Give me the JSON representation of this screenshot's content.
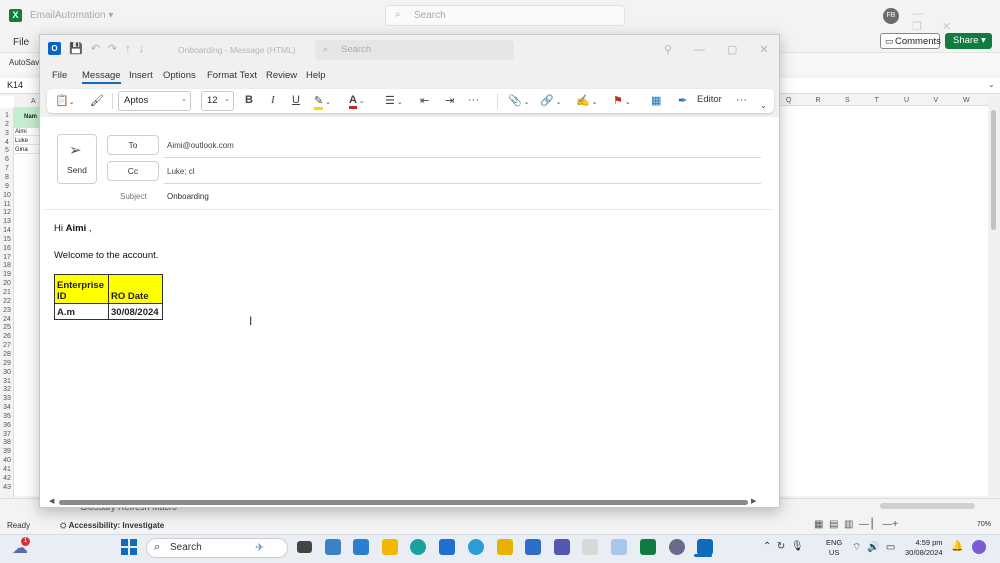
{
  "excel": {
    "app_letter": "X",
    "file_name": "EmailAutomation ▾",
    "search_placeholder": "Search",
    "avatar_initials": "FB",
    "menu_file": "File",
    "comments_label": "Comments",
    "share_label": "Share",
    "autosave_label": "AutoSave",
    "name_box": "K14",
    "column_a_letter": "A",
    "name_header": "Nam",
    "names": [
      "Aimi",
      "Luke",
      "Gina"
    ],
    "row_numbers": [
      "1",
      "2",
      "3",
      "4",
      "5",
      "6",
      "7",
      "8",
      "9",
      "10",
      "11",
      "12",
      "13",
      "14",
      "15",
      "16",
      "17",
      "18",
      "19",
      "20",
      "21",
      "22",
      "23",
      "24",
      "25",
      "26",
      "27",
      "28",
      "29",
      "30",
      "31",
      "32",
      "33",
      "34",
      "35",
      "36",
      "37",
      "38",
      "39",
      "40",
      "41",
      "42",
      "43"
    ],
    "right_columns": [
      "Q",
      "R",
      "S",
      "T",
      "U",
      "V",
      "W"
    ],
    "sheet_tab": "Glossary Refresh Macro",
    "status_ready": "Ready",
    "accessibility": "Accessibility: Investigate",
    "zoom": "70%"
  },
  "outlook": {
    "app_letter": "O",
    "window_title": "Onboarding  -  Message (HTML)",
    "search_placeholder": "Search",
    "tabs": [
      "File",
      "Message",
      "Insert",
      "Options",
      "Format Text",
      "Review",
      "Help"
    ],
    "active_tab": "Message",
    "ribbon": {
      "font_name": "Aptos",
      "font_size": "12",
      "bold": "B",
      "italic": "I",
      "underline": "U",
      "editor_label": "Editor",
      "more": "···"
    },
    "compose": {
      "send_label": "Send",
      "to_label": "To",
      "to_value": "Aimi@outlook.com",
      "cc_label": "Cc",
      "cc_value": "Luke; cl",
      "subject_label": "Subject",
      "subject_value": "Onboarding"
    },
    "body": {
      "greeting_prefix": "Hi ",
      "greeting_name": "Aimi",
      "greeting_suffix": " ,",
      "welcome": "Welcome to the account.",
      "table": {
        "headers": [
          "Enterprise ID",
          "RO Date"
        ],
        "rows": [
          [
            "A.m",
            "30/08/2024"
          ]
        ]
      }
    }
  },
  "taskbar": {
    "notification_count": "1",
    "search_label": "Search",
    "lang_line1": "ENG",
    "lang_line2": "US",
    "time": "4:59 pm",
    "date": "30/08/2024"
  },
  "colors": {
    "excel_green": "#107c41",
    "outlook_blue": "#0f6cbd",
    "table_header_yellow": "#ffff00",
    "font_color_red": "#c42b1c",
    "highlight_yellow": "#ffd800"
  }
}
